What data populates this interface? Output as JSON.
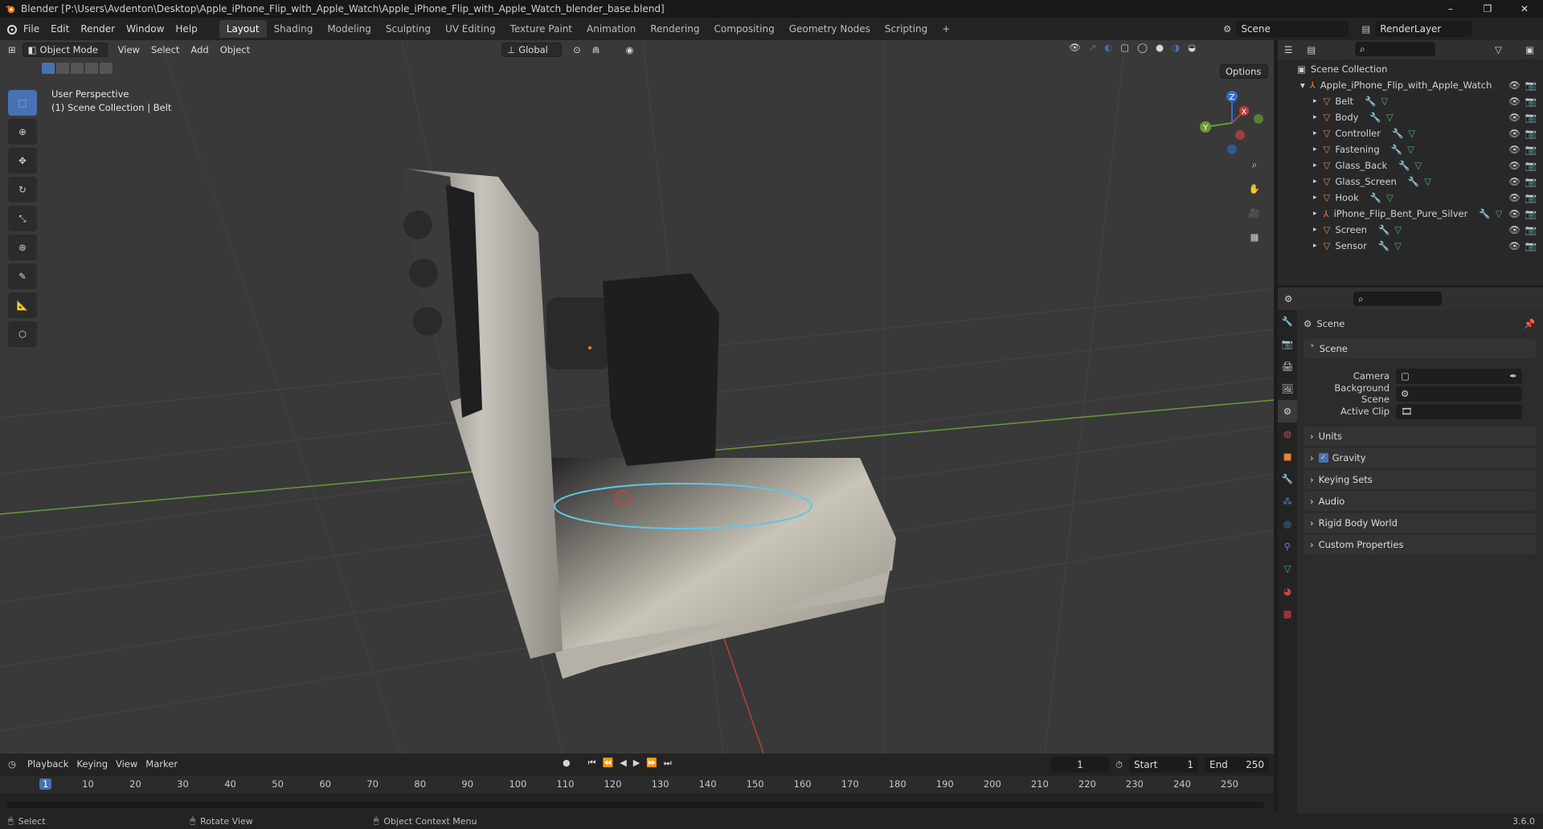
{
  "titlebar": {
    "title": "Blender [P:\\Users\\Avdenton\\Desktop\\Apple_iPhone_Flip_with_Apple_Watch\\Apple_iPhone_Flip_with_Apple_Watch_blender_base.blend]",
    "min": "–",
    "max": "❐",
    "close": "✕"
  },
  "menu": {
    "file": "File",
    "edit": "Edit",
    "render": "Render",
    "window": "Window",
    "help": "Help"
  },
  "workspaces": [
    "Layout",
    "Shading",
    "Modeling",
    "Sculpting",
    "UV Editing",
    "Texture Paint",
    "Animation",
    "Rendering",
    "Compositing",
    "Geometry Nodes",
    "Scripting",
    "+"
  ],
  "scene": {
    "name": "Scene",
    "render_layer": "RenderLayer"
  },
  "viewport": {
    "mode": "Object Mode",
    "view": "View",
    "select": "Select",
    "add": "Add",
    "object": "Object",
    "transform": "Global",
    "options": "Options",
    "perspective": "User Perspective",
    "collection_info": "(1) Scene Collection | Belt",
    "gizmo": {
      "x": "X",
      "y": "Y",
      "z": "Z"
    }
  },
  "outliner": {
    "root": "Scene Collection",
    "collection": "Apple_iPhone_Flip_with_Apple_Watch",
    "items": [
      {
        "name": "Belt"
      },
      {
        "name": "Body"
      },
      {
        "name": "Controller"
      },
      {
        "name": "Fastening"
      },
      {
        "name": "Glass_Back"
      },
      {
        "name": "Glass_Screen"
      },
      {
        "name": "Hook"
      },
      {
        "name": "iPhone_Flip_Bent_Pure_Silver"
      },
      {
        "name": "Screen"
      },
      {
        "name": "Sensor"
      }
    ]
  },
  "properties": {
    "header": "Scene",
    "section": "Scene",
    "camera_label": "Camera",
    "bg_scene_label": "Background Scene",
    "active_clip_label": "Active Clip",
    "panels": [
      "Units",
      "Gravity",
      "Keying Sets",
      "Audio",
      "Rigid Body World",
      "Custom Properties"
    ]
  },
  "timeline": {
    "playback": "Playback",
    "keying": "Keying",
    "view": "View",
    "marker": "Marker",
    "current_frame": "1",
    "start_label": "Start",
    "start": "1",
    "end_label": "End",
    "end": "250",
    "ticks": [
      "1",
      "10",
      "20",
      "30",
      "40",
      "50",
      "60",
      "70",
      "80",
      "90",
      "100",
      "110",
      "120",
      "130",
      "140",
      "150",
      "160",
      "170",
      "180",
      "190",
      "200",
      "210",
      "220",
      "230",
      "240",
      "250"
    ]
  },
  "statusbar": {
    "select": "Select",
    "rotate": "Rotate View",
    "context": "Object Context Menu",
    "version": "3.6.0"
  },
  "colors": {
    "accent": "#4772b3",
    "xaxis": "#b8403f",
    "yaxis": "#6a9a35",
    "zaxis": "#2f6ed6",
    "mesh_orange": "#e9823a"
  }
}
